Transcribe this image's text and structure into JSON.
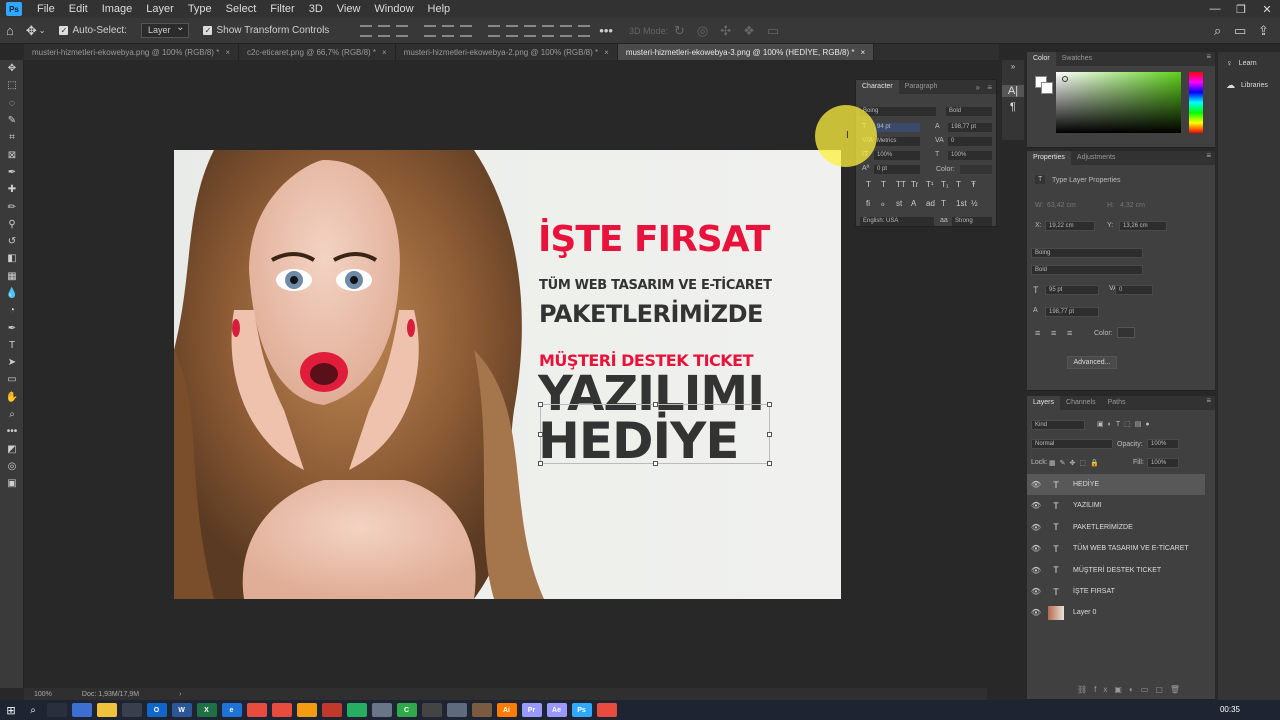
{
  "menubar": {
    "logo": "Ps",
    "items": [
      "File",
      "Edit",
      "Image",
      "Layer",
      "Type",
      "Select",
      "Filter",
      "3D",
      "View",
      "Window",
      "Help"
    ],
    "controls": [
      "—",
      "❐",
      "✕"
    ]
  },
  "options": {
    "auto_select_label": "Auto-Select:",
    "auto_select_target": "Layer",
    "transform_label": "Show Transform Controls",
    "mode3d_label": "3D Mode:"
  },
  "tabs": [
    {
      "label": "musteri-hizmetleri-ekowebya.png @ 100% (RGB/8) *",
      "active": false
    },
    {
      "label": "c2c-eticaret.png @ 66,7% (RGB/8) *",
      "active": false
    },
    {
      "label": "musteri-hizmetleri-ekowebya-2.png @ 100% (RGB/8) *",
      "active": false
    },
    {
      "label": "musteri-hizmetleri-ekowebya-3.png @ 100% (HEDİYE, RGB/8) *",
      "active": true
    }
  ],
  "tools": [
    "move",
    "marquee",
    "lasso",
    "quick-select",
    "crop",
    "frame",
    "eyedropper",
    "healing",
    "brush",
    "stamp",
    "history-brush",
    "eraser",
    "gradient",
    "blur",
    "dodge",
    "pen",
    "type",
    "path-select",
    "shape",
    "hand",
    "zoom",
    "more",
    "colors",
    "quick-mask",
    "screen-mode"
  ],
  "poster": {
    "line1": "İŞTE FIRSAT",
    "line2": "TÜM WEB TASARIM VE  E-TİCARET",
    "line3": "PAKETLERİMİZDE",
    "line4": "MÜŞTERİ DESTEK TICKET",
    "line5": "YAZILIMI",
    "line6": "HEDİYE"
  },
  "status": {
    "zoom": "100%",
    "doc": "Doc: 1,93M/17,9M"
  },
  "character": {
    "tabs": [
      "Character",
      "Paragraph"
    ],
    "font_family": "Boing",
    "font_style": "Bold",
    "size": "94 pt",
    "leading": "198,77 pt",
    "kerning": "Metrics",
    "tracking": "0",
    "vscale": "100%",
    "hscale": "100%",
    "baseline": "0 pt",
    "color_label": "Color:",
    "language": "English: USA",
    "antialias": "Strong",
    "style_buttons": [
      "T",
      "T",
      "TT",
      "Tr",
      "T¹",
      "T₁",
      "T",
      "Ŧ"
    ],
    "ot_buttons": [
      "fi",
      "ℴ",
      "st",
      "A",
      "ad",
      "T",
      "1st",
      "½"
    ]
  },
  "color_panel": {
    "tabs": [
      "Color",
      "Swatches"
    ],
    "fg": "#ffffff",
    "bg": "#ffffff",
    "picker_hue": "#5ed11b"
  },
  "properties": {
    "tabs": [
      "Properties",
      "Adjustments"
    ],
    "title": "Type Layer Properties",
    "w_label": "W:",
    "w_value": "63,42 cm",
    "h_label": "H:",
    "h_value": "4,32 cm",
    "x_label": "X:",
    "x_value": "19,22 cm",
    "y_label": "Y:",
    "y_value": "13,26 cm",
    "font_family": "Boing",
    "font_style": "Bold",
    "size": "95 pt",
    "tracking": "0",
    "leading": "198,77 pt",
    "color_label": "Color:",
    "advanced": "Advanced..."
  },
  "layers": {
    "tabs": [
      "Layers",
      "Channels",
      "Paths"
    ],
    "filter": "Kind",
    "blend": "Normal",
    "opacity_label": "Opacity:",
    "opacity": "100%",
    "lock_label": "Lock:",
    "fill_label": "Fill:",
    "fill": "100%",
    "items": [
      {
        "name": "HEDİYE",
        "type": "T",
        "selected": true
      },
      {
        "name": "YAZILIMI",
        "type": "T",
        "selected": false
      },
      {
        "name": "PAKETLERİMİZDE",
        "type": "T",
        "selected": false
      },
      {
        "name": "TÜM WEB TASARIM VE  E-TİCARET",
        "type": "T",
        "selected": false
      },
      {
        "name": "MÜŞTERİ DESTEK TICKET",
        "type": "T",
        "selected": false
      },
      {
        "name": "İŞTE FIRSAT",
        "type": "T",
        "selected": false
      },
      {
        "name": "Layer 0",
        "type": "img",
        "selected": false
      }
    ]
  },
  "learn": {
    "items": [
      "Learn",
      "Libraries"
    ]
  },
  "taskbar": {
    "apps": [
      {
        "label": "",
        "color": "#2a2f3d"
      },
      {
        "label": "",
        "color": "#3b6fd1"
      },
      {
        "label": "",
        "color": "#f0c23b"
      },
      {
        "label": "",
        "color": "#3a3f4d"
      },
      {
        "label": "O",
        "color": "#1066c9"
      },
      {
        "label": "W",
        "color": "#2b5797"
      },
      {
        "label": "X",
        "color": "#1e7145"
      },
      {
        "label": "e",
        "color": "#1e73d6"
      },
      {
        "label": "",
        "color": "#e74c3c"
      },
      {
        "label": "",
        "color": "#e74c3c"
      },
      {
        "label": "",
        "color": "#f39c12"
      },
      {
        "label": "",
        "color": "#c0392b"
      },
      {
        "label": "",
        "color": "#27ae60"
      },
      {
        "label": "",
        "color": "#6a7688"
      },
      {
        "label": "C",
        "color": "#2fa94a"
      },
      {
        "label": "",
        "color": "#444"
      },
      {
        "label": "",
        "color": "#5f6b7d"
      },
      {
        "label": "",
        "color": "#7a5b3f"
      },
      {
        "label": "Ai",
        "color": "#ff7c00"
      },
      {
        "label": "Pr",
        "color": "#9999ff"
      },
      {
        "label": "Ae",
        "color": "#9999ff"
      },
      {
        "label": "Ps",
        "color": "#31a8ff"
      },
      {
        "label": "",
        "color": "#e74c3c"
      }
    ],
    "clock": "00:35"
  }
}
